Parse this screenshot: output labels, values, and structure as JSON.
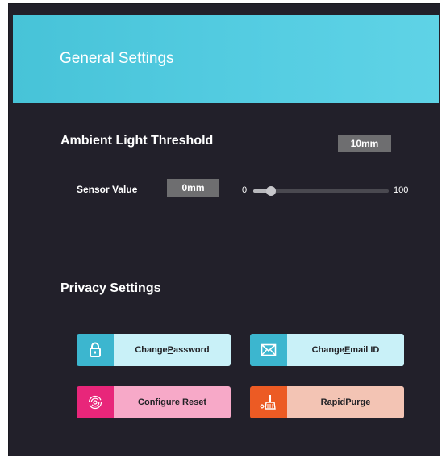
{
  "header": {
    "title": "General Settings"
  },
  "ambient": {
    "title": "Ambient Light Threshold",
    "threshold_value": "10mm",
    "sensor_label": "Sensor Value",
    "sensor_value": "0mm",
    "slider": {
      "min": "0",
      "max": "100",
      "value": 13
    }
  },
  "privacy": {
    "title": "Privacy Settings",
    "buttons": [
      {
        "pre": "Change ",
        "hot": "P",
        "post": "assword",
        "icon": "lock-icon"
      },
      {
        "pre": "Change ",
        "hot": "E",
        "post": "mail ID",
        "icon": "mail-icon"
      },
      {
        "pre": "",
        "hot": "C",
        "post": "onfigure Reset",
        "icon": "fingerprint-icon"
      },
      {
        "pre": "Rapid ",
        "hot": "P",
        "post": "urge",
        "icon": "purge-icon"
      }
    ]
  },
  "colors": {
    "panel_bg": "#22202a",
    "header_bg": "#55cde2",
    "blue_icon": "#3cb6cf",
    "blue_text_bg": "#c9f1f8",
    "pink_icon": "#e8267a",
    "pink_text_bg": "#f7a9c8",
    "orange_icon": "#ec5b24",
    "orange_text_bg": "#f3c4b4"
  }
}
